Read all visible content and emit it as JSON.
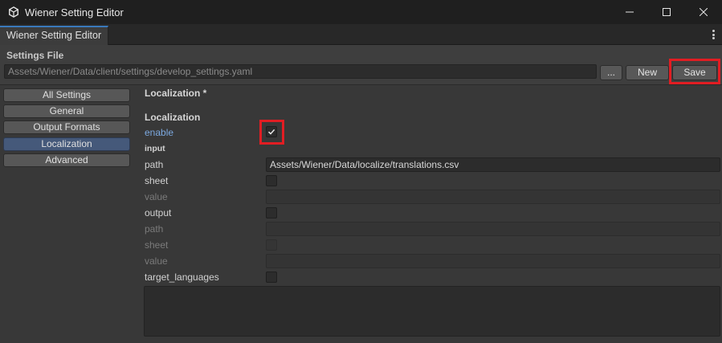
{
  "window": {
    "title": "Wiener Setting Editor"
  },
  "tab": {
    "label": "Wiener Setting Editor"
  },
  "settings_file": {
    "label": "Settings File",
    "path": "Assets/Wiener/Data/client/settings/develop_settings.yaml",
    "browse_label": "...",
    "new_label": "New",
    "save_label": "Save"
  },
  "sidebar": {
    "items": [
      {
        "label": "All Settings"
      },
      {
        "label": "General"
      },
      {
        "label": "Output Formats"
      },
      {
        "label": "Localization",
        "active": true
      },
      {
        "label": "Advanced"
      }
    ]
  },
  "main": {
    "title": "Localization *",
    "section": "Localization",
    "enable_label": "enable",
    "enable_checked": true,
    "input_label": "input",
    "input_path_label": "path",
    "input_path_value": "Assets/Wiener/Data/localize/translations.csv",
    "input_sheet_label": "sheet",
    "input_value_label": "value",
    "output_label": "output",
    "output_path_label": "path",
    "output_sheet_label": "sheet",
    "output_value_label": "value",
    "target_languages_label": "target_languages"
  },
  "colors": {
    "accent": "#3a79bb",
    "highlight": "#e11d23",
    "active_nav": "#45597a",
    "link_label": "#7ca9e0"
  }
}
